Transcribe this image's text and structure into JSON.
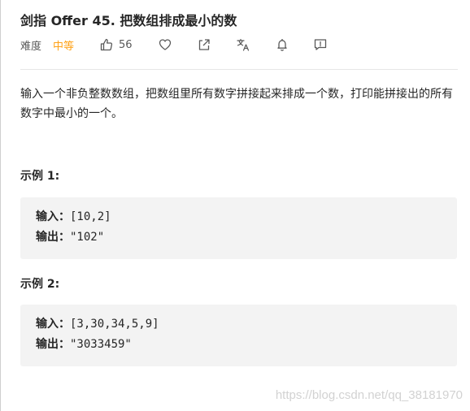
{
  "problem": {
    "title": "剑指 Offer 45. 把数组排成最小的数",
    "difficulty_label": "难度",
    "difficulty_value": "中等",
    "likes": "56",
    "description": "输入一个非负整数数组，把数组里所有数字拼接起来排成一个数，打印能拼接出的所有数字中最小的一个。"
  },
  "examples": [
    {
      "title": "示例 1:",
      "input_label": "输入：",
      "input_value": "[10,2]",
      "output_label": "输出：",
      "output_value": "\"102\""
    },
    {
      "title": "示例 2:",
      "input_label": "输入：",
      "input_value": "[3,30,34,5,9]",
      "output_label": "输出：",
      "output_value": "\"3033459\""
    }
  ],
  "watermark": "https://blog.csdn.net/qq_38181970",
  "colors": {
    "difficulty_medium": "#ffa116",
    "code_bg": "#f3f3f3"
  },
  "icons": [
    "thumbs-up-icon",
    "heart-icon",
    "share-icon",
    "translate-icon",
    "bell-icon",
    "feedback-icon"
  ]
}
